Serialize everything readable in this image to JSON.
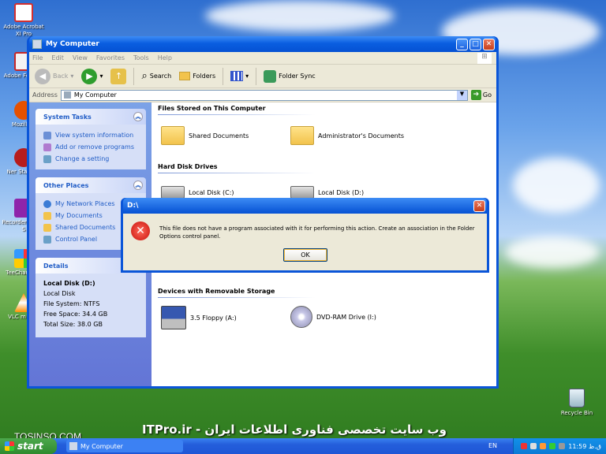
{
  "desktop": {
    "icons": [
      {
        "label": "Adobe Acrobat XI Pro",
        "color": "#d32f2f"
      },
      {
        "label": "Adobe FormsC",
        "color": "#c62828"
      },
      {
        "label": "Mozilla F",
        "color": "#e65100"
      },
      {
        "label": "Ner StartSm",
        "color": "#b71c1c"
      },
      {
        "label": "Recorder Series S",
        "color": "#8e24aa"
      },
      {
        "label": "TeeChart Offi",
        "color": "#00897b"
      },
      {
        "label": "VLC m play",
        "color": "#ff8f00"
      }
    ],
    "recycle_bin": "Recycle Bin",
    "watermark_left": "TOSINSO.COM",
    "watermark_center": "ITPro.ir - وب سایت تخصصی فناوری اطلاعات ایران"
  },
  "window": {
    "title": "My Computer",
    "buttons": {
      "minimize": "_",
      "maximize": "□",
      "close": "✕"
    },
    "menu": [
      "File",
      "Edit",
      "View",
      "Favorites",
      "Tools",
      "Help"
    ],
    "toolbar": {
      "back": "Back",
      "search": "Search",
      "folders": "Folders",
      "folder_sync": "Folder Sync"
    },
    "address": {
      "label": "Address",
      "value": "My Computer",
      "go": "Go"
    },
    "left_pane": {
      "system_tasks": {
        "title": "System Tasks",
        "links": [
          "View system information",
          "Add or remove programs",
          "Change a setting"
        ]
      },
      "other_places": {
        "title": "Other Places",
        "links": [
          "My Network Places",
          "My Documents",
          "Shared Documents",
          "Control Panel"
        ]
      },
      "details": {
        "title": "Details",
        "name": "Local Disk (D:)",
        "type": "Local Disk",
        "file_system": "File System: NTFS",
        "free_space": "Free Space: 34.4 GB",
        "total_size": "Total Size: 38.0 GB"
      }
    },
    "groups": {
      "stored": {
        "title": "Files Stored on This Computer",
        "items": [
          "Shared Documents",
          "Administrator's Documents"
        ]
      },
      "hard_disks": {
        "title": "Hard Disk Drives",
        "items": [
          "Local Disk (C:)",
          "Local Disk (D:)"
        ]
      },
      "removable": {
        "title": "Devices with Removable Storage",
        "items": [
          "3.5 Floppy (A:)",
          "DVD-RAM Drive (I:)"
        ]
      }
    }
  },
  "dialog": {
    "title": "D:\\",
    "message": "This file does not have a program associated with it for performing this action. Create an association in the Folder Options control panel.",
    "ok": "OK",
    "close": "✕",
    "error_glyph": "✕"
  },
  "taskbar": {
    "start": "start",
    "task": "My Computer",
    "language": "EN",
    "clock": "11:59 ق.ظ"
  }
}
